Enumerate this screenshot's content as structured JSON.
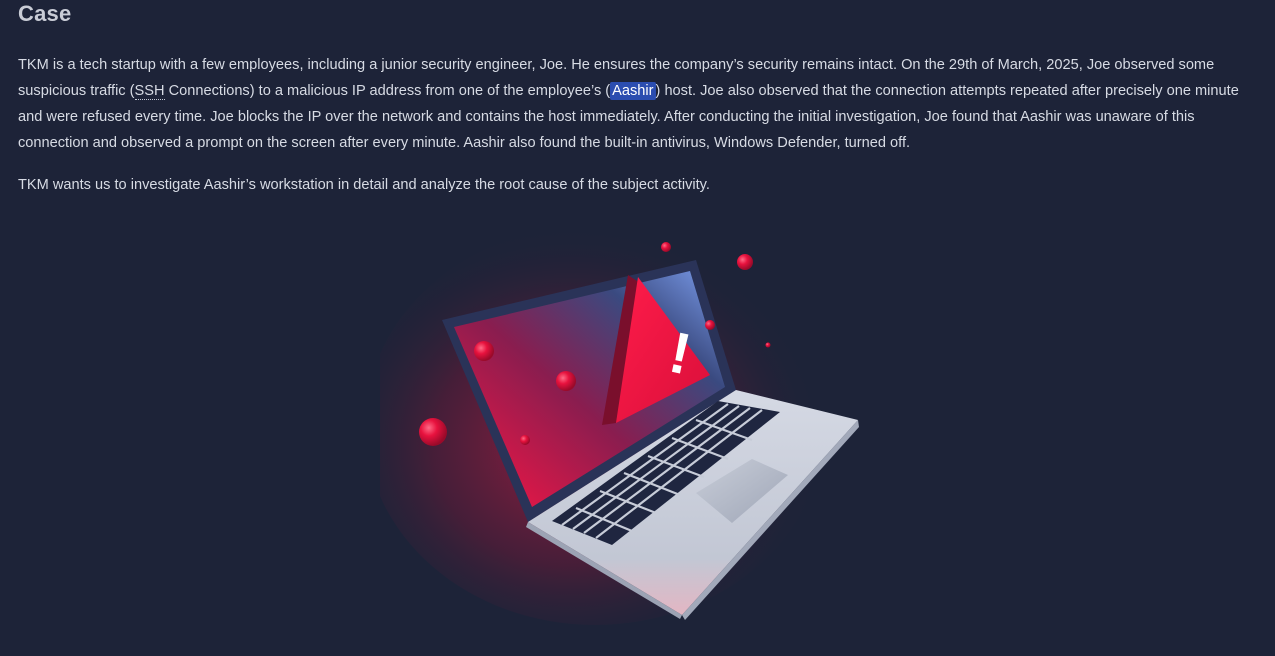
{
  "section": {
    "title": "Case"
  },
  "paragraph1": {
    "part1": "TKM is a tech startup with a few employees, including a junior security engineer, Joe. He ensures the company’s security remains intact. On the 29th of March, 2025, Joe observed some suspicious traffic (",
    "abbr": "SSH",
    "part2": " Connections) to a malicious IP address from one of the employee’s (",
    "highlight": "Aashir",
    "part3": ") host. Joe also observed that the connection attempts repeated after precisely one minute and were refused every time. Joe blocks the IP over the network and contains the host immediately. After conducting the initial investigation, Joe found that Aashir was unaware of this connection and observed a prompt on the screen after every minute. Aashir also found the built-in antivirus, Windows Defender, turned off."
  },
  "paragraph2": {
    "text": "TKM wants us to investigate Aashir’s workstation in detail and analyze the root cause of the subject activity."
  },
  "illustration": {
    "icon": "laptop-warning-illustration",
    "warning_glyph": "!",
    "colors": {
      "background": "#1d2338",
      "alert_red": "#e8123e",
      "screen_blue": "#6c8fe6",
      "laptop_body": "#c7ccd8",
      "keys": "#1f2640"
    }
  }
}
